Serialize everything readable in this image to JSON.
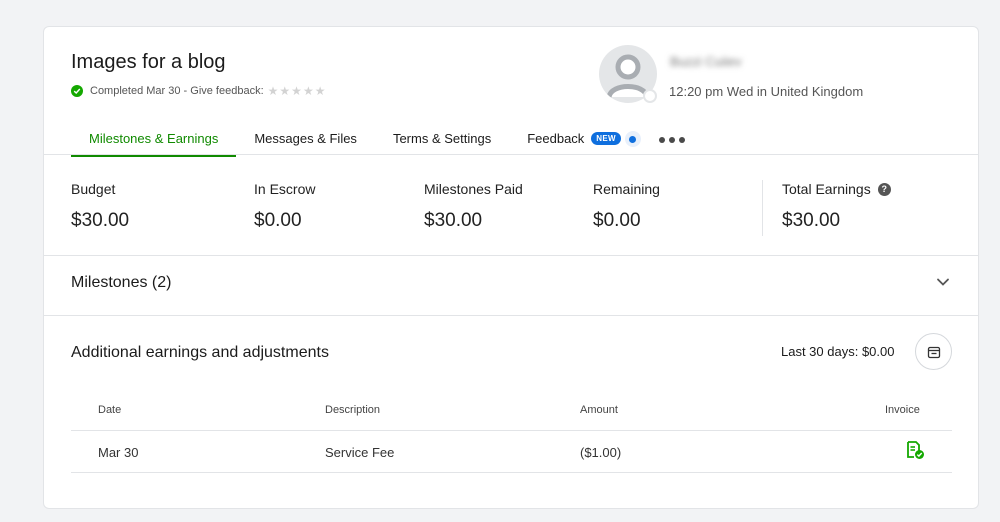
{
  "contract": {
    "title": "Images for a blog",
    "status": "Completed Mar 30 - Give feedback:",
    "rating_stars": 5
  },
  "user": {
    "name": "Buzzi Cuiiev",
    "local_time": "12:20 pm Wed in United Kingdom"
  },
  "tabs": [
    {
      "label": "Milestones & Earnings",
      "active": true
    },
    {
      "label": "Messages & Files"
    },
    {
      "label": "Terms & Settings"
    },
    {
      "label": "Feedback",
      "badge": "NEW"
    }
  ],
  "stats": [
    {
      "label": "Budget",
      "value": "$30.00"
    },
    {
      "label": "In Escrow",
      "value": "$0.00"
    },
    {
      "label": "Milestones Paid",
      "value": "$30.00"
    },
    {
      "label": "Remaining",
      "value": "$0.00"
    },
    {
      "label": "Total Earnings",
      "value": "$30.00"
    }
  ],
  "milestones": {
    "label": "Milestones (2)"
  },
  "adjustments": {
    "title": "Additional earnings and adjustments",
    "last30": "Last 30 days: $0.00",
    "columns": [
      "Date",
      "Description",
      "Amount",
      "Invoice"
    ],
    "rows": [
      {
        "date": "Mar 30",
        "description": "Service Fee",
        "amount": "($1.00)"
      }
    ]
  },
  "colors": {
    "accent": "#108a00",
    "success": "#14a800",
    "badge": "#0f6fde"
  }
}
